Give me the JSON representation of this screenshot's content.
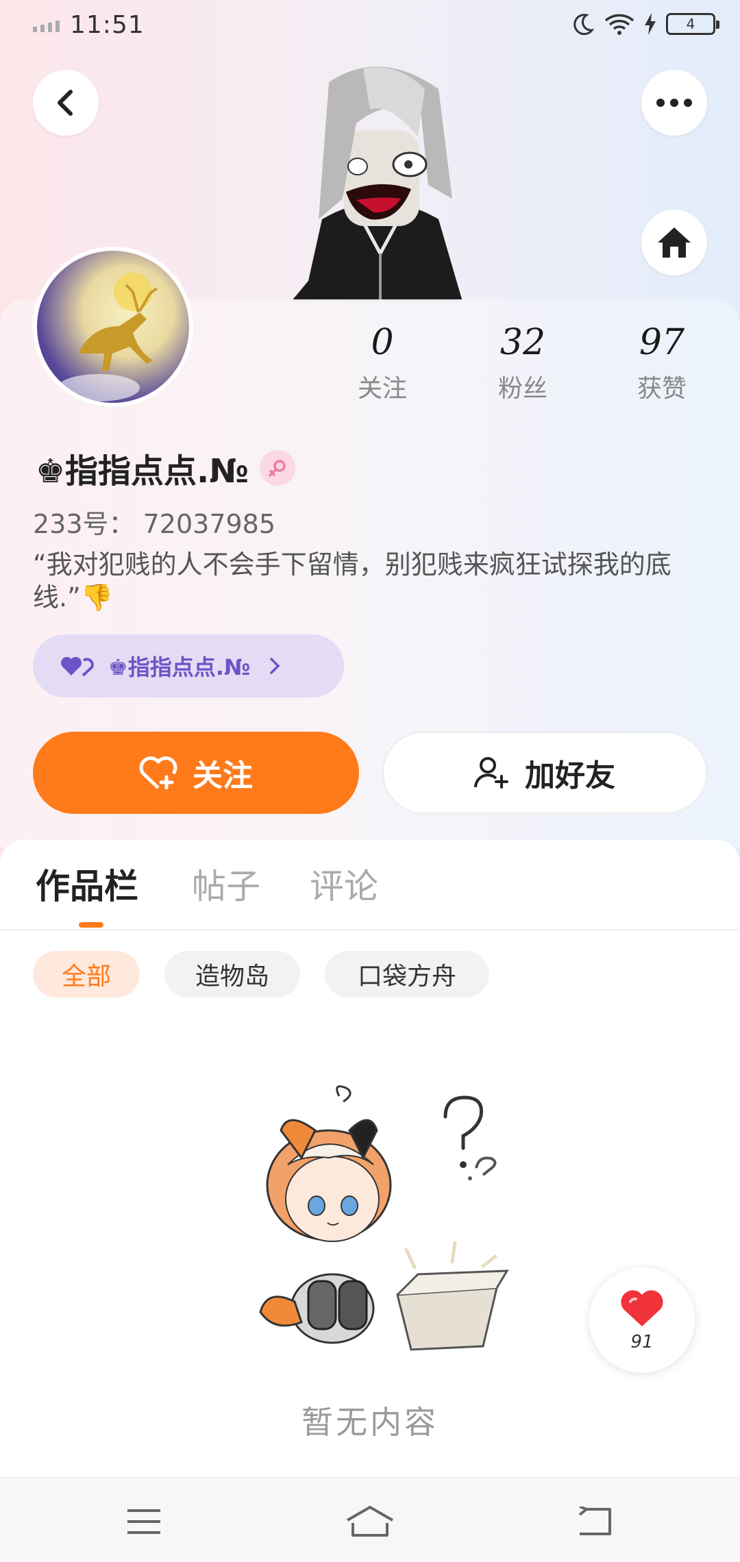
{
  "status_bar": {
    "time": "11:51",
    "battery": "4"
  },
  "header": {
    "back_icon": "back-icon",
    "more_icon": "more-icon",
    "home_icon": "home-icon"
  },
  "profile": {
    "stats": [
      {
        "value": "0",
        "label": "关注"
      },
      {
        "value": "32",
        "label": "粉丝"
      },
      {
        "value": "97",
        "label": "获赞"
      }
    ],
    "nickname": "♚指指点点.№",
    "gender": "female",
    "uid": "233号： 72037985",
    "bio": "“我对犯贱的人不会手下留情，别犯贱来疯狂试探我的底线.”👎",
    "tag_pill": "♚指指点点.№"
  },
  "actions": {
    "follow_label": "关注",
    "add_friend_label": "加好友"
  },
  "tabs": [
    {
      "label": "作品栏",
      "active": true
    },
    {
      "label": "帖子",
      "active": false
    },
    {
      "label": "评论",
      "active": false
    }
  ],
  "filters": [
    {
      "label": "全部",
      "active": true
    },
    {
      "label": "造物岛",
      "active": false
    },
    {
      "label": "口袋方舟",
      "active": false
    }
  ],
  "empty_state": {
    "text": "暂无内容"
  },
  "like_fab": {
    "count": "91"
  },
  "colors": {
    "accent": "#ff7a1a",
    "tag_purple": "#6c54c6",
    "gender_pink": "#f07aa0",
    "heart": "#f0323a"
  }
}
